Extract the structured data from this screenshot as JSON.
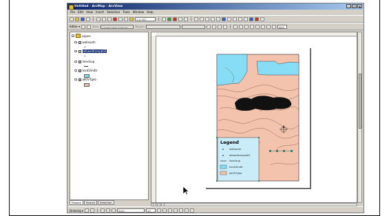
{
  "app": {
    "title": "Untitled - ArcMap - ArcView"
  },
  "window_buttons": {
    "minimize": "_",
    "maximize": "□",
    "close": "x"
  },
  "menu": [
    "File",
    "Edit",
    "View",
    "Insert",
    "Selection",
    "Tools",
    "Window",
    "Help"
  ],
  "toolbar": {
    "scale_value": "1:5,357",
    "zoom_value": "48%"
  },
  "editor": {
    "editor_label": "Editor ▾",
    "task_placeholder": "Create New Feature",
    "target_label": "Target:"
  },
  "toc": {
    "root_label": "Layers",
    "layers": [
      {
        "name": "wellsouth",
        "selected": false,
        "checked": true
      },
      {
        "name": "alltwelltrampb02",
        "selected": true,
        "checked": true
      },
      {
        "name": "lineclsup",
        "selected": false,
        "checked": true
      },
      {
        "name": "tocd1lmdtr",
        "selected": false,
        "checked": true
      },
      {
        "name": "allOVTgeo",
        "selected": false,
        "checked": true
      }
    ],
    "tabs": [
      "Display",
      "Source",
      "Selection"
    ]
  },
  "legend": {
    "title": "Legend",
    "items": [
      "wellsouth",
      "alltwelltrampb02",
      "lineclsup",
      "tocd1lmdtr",
      "allOVTgeo"
    ]
  },
  "drawing": {
    "drawing_label": "Drawing ▾",
    "font_name": "Arial",
    "font_size": "10"
  },
  "colors": {
    "title_gradient_start": "#0a246a",
    "selection": "#0a246a",
    "water": "#87ddf5",
    "geology": "#f3c3ad",
    "contour": "#8a5a40",
    "legend_bg": "#c9ecf8"
  }
}
